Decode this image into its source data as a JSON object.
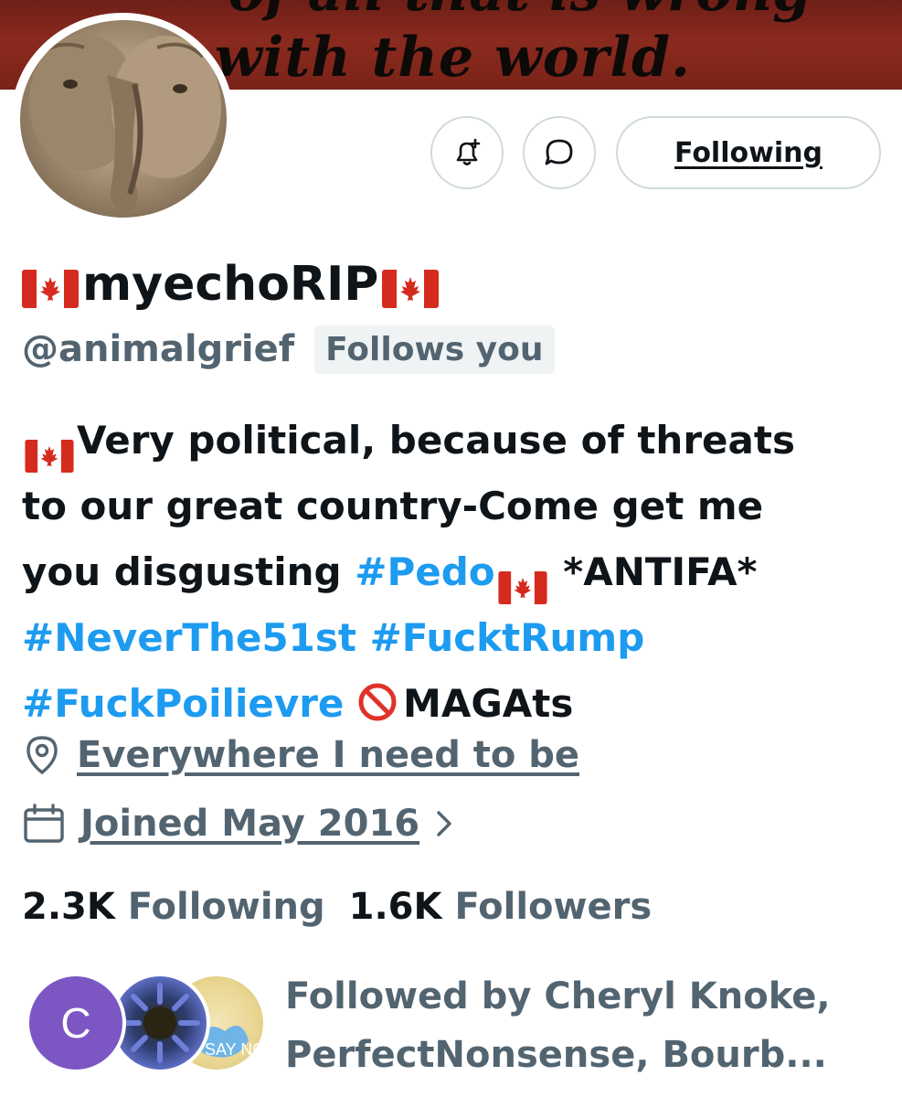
{
  "banner": {
    "text_line1": "of all that is wrong",
    "text_line2": "with the world."
  },
  "actions": {
    "notify_icon": "bell-plus-icon",
    "message_icon": "message-bubble-icon",
    "following_label": "Following"
  },
  "profile": {
    "display_name": "myechoRIP",
    "name_flag_icon": "canada-flag-icon",
    "handle": "@animalgrief",
    "follows_you_badge": "Follows you"
  },
  "bio": {
    "line1_text": "Very political, because of threats",
    "line2_text": "to our great country-Come get me",
    "line3_text": "you disgusting ",
    "line3_tag": "#Pedo",
    "line3_after": " *ANTIFA*",
    "line4_tag1": "#NeverThe51st",
    "line4_tag2": "#FucktRump",
    "line5_tag": "#FuckPoilievre",
    "line5_after": "MAGAts",
    "no_entry_icon": "no-entry-icon"
  },
  "meta": {
    "location_icon": "location-pin-icon",
    "location": "Everywhere I need to be",
    "joined_icon": "calendar-icon",
    "joined": "Joined May 2016",
    "chevron_icon": "chevron-right-icon"
  },
  "counts": {
    "following_count": "2.3K",
    "following_label": "Following",
    "followers_count": "1.6K",
    "followers_label": "Followers"
  },
  "followed_by": {
    "line1": "Followed by Cheryl Knoke,",
    "line2": "PerfectNonsense, Bourb...",
    "avatar1_initial": "C",
    "avatar3_text": "SAY NO",
    "colors": {
      "avatar1_bg": "#7c57c4",
      "link_blue": "#1d9bf0",
      "muted": "#536471"
    }
  }
}
